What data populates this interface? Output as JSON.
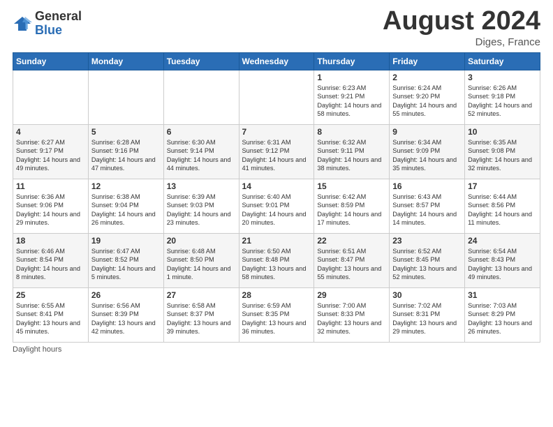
{
  "logo": {
    "general": "General",
    "blue": "Blue"
  },
  "title": "August 2024",
  "location": "Diges, France",
  "days_of_week": [
    "Sunday",
    "Monday",
    "Tuesday",
    "Wednesday",
    "Thursday",
    "Friday",
    "Saturday"
  ],
  "footer": "Daylight hours",
  "weeks": [
    [
      {
        "num": "",
        "info": ""
      },
      {
        "num": "",
        "info": ""
      },
      {
        "num": "",
        "info": ""
      },
      {
        "num": "",
        "info": ""
      },
      {
        "num": "1",
        "info": "Sunrise: 6:23 AM\nSunset: 9:21 PM\nDaylight: 14 hours\nand 58 minutes."
      },
      {
        "num": "2",
        "info": "Sunrise: 6:24 AM\nSunset: 9:20 PM\nDaylight: 14 hours\nand 55 minutes."
      },
      {
        "num": "3",
        "info": "Sunrise: 6:26 AM\nSunset: 9:18 PM\nDaylight: 14 hours\nand 52 minutes."
      }
    ],
    [
      {
        "num": "4",
        "info": "Sunrise: 6:27 AM\nSunset: 9:17 PM\nDaylight: 14 hours\nand 49 minutes."
      },
      {
        "num": "5",
        "info": "Sunrise: 6:28 AM\nSunset: 9:16 PM\nDaylight: 14 hours\nand 47 minutes."
      },
      {
        "num": "6",
        "info": "Sunrise: 6:30 AM\nSunset: 9:14 PM\nDaylight: 14 hours\nand 44 minutes."
      },
      {
        "num": "7",
        "info": "Sunrise: 6:31 AM\nSunset: 9:12 PM\nDaylight: 14 hours\nand 41 minutes."
      },
      {
        "num": "8",
        "info": "Sunrise: 6:32 AM\nSunset: 9:11 PM\nDaylight: 14 hours\nand 38 minutes."
      },
      {
        "num": "9",
        "info": "Sunrise: 6:34 AM\nSunset: 9:09 PM\nDaylight: 14 hours\nand 35 minutes."
      },
      {
        "num": "10",
        "info": "Sunrise: 6:35 AM\nSunset: 9:08 PM\nDaylight: 14 hours\nand 32 minutes."
      }
    ],
    [
      {
        "num": "11",
        "info": "Sunrise: 6:36 AM\nSunset: 9:06 PM\nDaylight: 14 hours\nand 29 minutes."
      },
      {
        "num": "12",
        "info": "Sunrise: 6:38 AM\nSunset: 9:04 PM\nDaylight: 14 hours\nand 26 minutes."
      },
      {
        "num": "13",
        "info": "Sunrise: 6:39 AM\nSunset: 9:03 PM\nDaylight: 14 hours\nand 23 minutes."
      },
      {
        "num": "14",
        "info": "Sunrise: 6:40 AM\nSunset: 9:01 PM\nDaylight: 14 hours\nand 20 minutes."
      },
      {
        "num": "15",
        "info": "Sunrise: 6:42 AM\nSunset: 8:59 PM\nDaylight: 14 hours\nand 17 minutes."
      },
      {
        "num": "16",
        "info": "Sunrise: 6:43 AM\nSunset: 8:57 PM\nDaylight: 14 hours\nand 14 minutes."
      },
      {
        "num": "17",
        "info": "Sunrise: 6:44 AM\nSunset: 8:56 PM\nDaylight: 14 hours\nand 11 minutes."
      }
    ],
    [
      {
        "num": "18",
        "info": "Sunrise: 6:46 AM\nSunset: 8:54 PM\nDaylight: 14 hours\nand 8 minutes."
      },
      {
        "num": "19",
        "info": "Sunrise: 6:47 AM\nSunset: 8:52 PM\nDaylight: 14 hours\nand 5 minutes."
      },
      {
        "num": "20",
        "info": "Sunrise: 6:48 AM\nSunset: 8:50 PM\nDaylight: 14 hours\nand 1 minute."
      },
      {
        "num": "21",
        "info": "Sunrise: 6:50 AM\nSunset: 8:48 PM\nDaylight: 13 hours\nand 58 minutes."
      },
      {
        "num": "22",
        "info": "Sunrise: 6:51 AM\nSunset: 8:47 PM\nDaylight: 13 hours\nand 55 minutes."
      },
      {
        "num": "23",
        "info": "Sunrise: 6:52 AM\nSunset: 8:45 PM\nDaylight: 13 hours\nand 52 minutes."
      },
      {
        "num": "24",
        "info": "Sunrise: 6:54 AM\nSunset: 8:43 PM\nDaylight: 13 hours\nand 49 minutes."
      }
    ],
    [
      {
        "num": "25",
        "info": "Sunrise: 6:55 AM\nSunset: 8:41 PM\nDaylight: 13 hours\nand 45 minutes."
      },
      {
        "num": "26",
        "info": "Sunrise: 6:56 AM\nSunset: 8:39 PM\nDaylight: 13 hours\nand 42 minutes."
      },
      {
        "num": "27",
        "info": "Sunrise: 6:58 AM\nSunset: 8:37 PM\nDaylight: 13 hours\nand 39 minutes."
      },
      {
        "num": "28",
        "info": "Sunrise: 6:59 AM\nSunset: 8:35 PM\nDaylight: 13 hours\nand 36 minutes."
      },
      {
        "num": "29",
        "info": "Sunrise: 7:00 AM\nSunset: 8:33 PM\nDaylight: 13 hours\nand 32 minutes."
      },
      {
        "num": "30",
        "info": "Sunrise: 7:02 AM\nSunset: 8:31 PM\nDaylight: 13 hours\nand 29 minutes."
      },
      {
        "num": "31",
        "info": "Sunrise: 7:03 AM\nSunset: 8:29 PM\nDaylight: 13 hours\nand 26 minutes."
      }
    ]
  ]
}
